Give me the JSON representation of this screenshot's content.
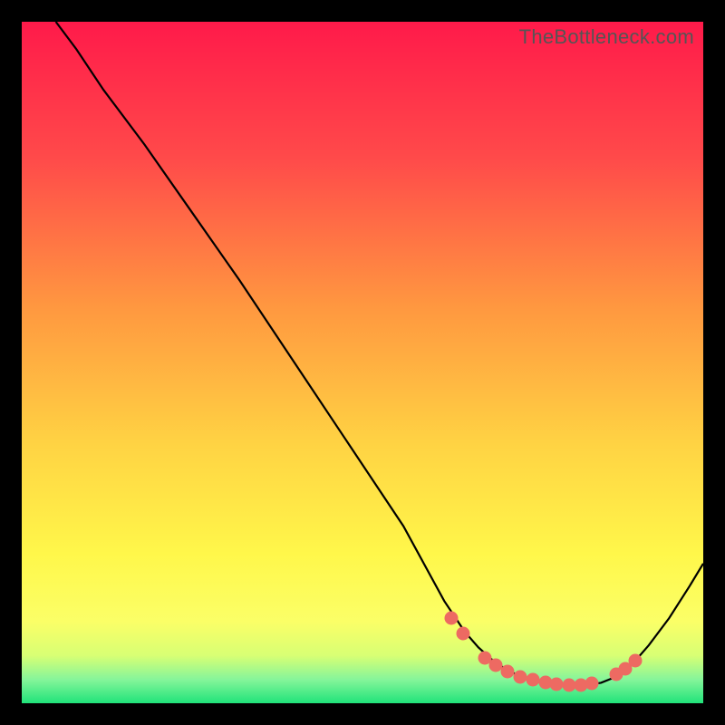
{
  "watermark": "TheBottleneck.com",
  "chart_data": {
    "type": "line",
    "title": "",
    "xlabel": "",
    "ylabel": "",
    "xlim": [
      0,
      100
    ],
    "ylim": [
      0,
      100
    ],
    "grid": false,
    "legend": false,
    "gradient_stops": [
      {
        "offset": 0.0,
        "color": "#ff1a4a"
      },
      {
        "offset": 0.2,
        "color": "#ff4a4a"
      },
      {
        "offset": 0.42,
        "color": "#ff9840"
      },
      {
        "offset": 0.62,
        "color": "#ffd343"
      },
      {
        "offset": 0.78,
        "color": "#fff74a"
      },
      {
        "offset": 0.88,
        "color": "#fbff67"
      },
      {
        "offset": 0.93,
        "color": "#d8ff74"
      },
      {
        "offset": 0.965,
        "color": "#86f59a"
      },
      {
        "offset": 1.0,
        "color": "#20e37a"
      }
    ],
    "series": [
      {
        "name": "curve",
        "color": "#000000",
        "width": 2.2,
        "x": [
          5,
          8,
          12,
          18,
          25,
          32,
          40,
          48,
          56,
          62,
          65,
          67,
          69,
          71,
          73,
          75,
          77,
          79,
          81,
          83,
          85,
          86.5,
          88,
          90,
          92,
          95,
          98,
          100
        ],
        "y": [
          100,
          96,
          90,
          82,
          72,
          62,
          50,
          38,
          26,
          15,
          10.5,
          8.2,
          6.4,
          5.0,
          4.0,
          3.3,
          2.9,
          2.7,
          2.6,
          2.7,
          3.0,
          3.6,
          4.5,
          6.2,
          8.5,
          12.5,
          17.2,
          20.5
        ]
      }
    ],
    "markers": {
      "color": "#ed6a62",
      "radius": 7.5,
      "points": [
        {
          "x": 63.0,
          "y": 12.5
        },
        {
          "x": 64.8,
          "y": 10.2
        },
        {
          "x": 68.0,
          "y": 6.6
        },
        {
          "x": 69.5,
          "y": 5.6
        },
        {
          "x": 71.3,
          "y": 4.6
        },
        {
          "x": 73.2,
          "y": 3.9
        },
        {
          "x": 75.0,
          "y": 3.4
        },
        {
          "x": 76.8,
          "y": 3.0
        },
        {
          "x": 78.5,
          "y": 2.8
        },
        {
          "x": 80.3,
          "y": 2.7
        },
        {
          "x": 82.0,
          "y": 2.7
        },
        {
          "x": 83.6,
          "y": 2.9
        },
        {
          "x": 87.3,
          "y": 4.2
        },
        {
          "x": 88.6,
          "y": 5.1
        },
        {
          "x": 90.0,
          "y": 6.2
        }
      ]
    }
  }
}
